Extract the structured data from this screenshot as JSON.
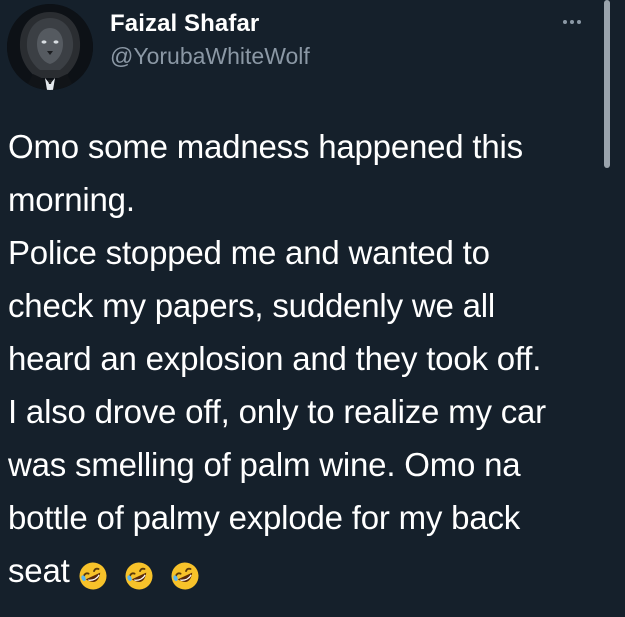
{
  "tweet": {
    "author_name": "Faizal Shafar",
    "author_handle": "@YorubaWhiteWolf",
    "avatar_icon": "lion-avatar-icon",
    "more_icon": "more-options-icon",
    "body_lines": [
      "Omo some madness happened this",
      "morning.",
      "Police stopped me and wanted to",
      "check my papers, suddenly we all",
      "heard an explosion and they took off.",
      "I also drove off, only to realize my car",
      "was smelling of palm wine. Omo na",
      "bottle of palmy explode for my back",
      "seat"
    ],
    "emojis": [
      "rolling-on-floor-laughing-emoji",
      "rolling-on-floor-laughing-emoji",
      "rolling-on-floor-laughing-emoji"
    ]
  },
  "colors": {
    "background": "#15202b",
    "text_primary": "#ffffff",
    "text_secondary": "#8b98a5",
    "emoji_face": "#f7c22a"
  }
}
